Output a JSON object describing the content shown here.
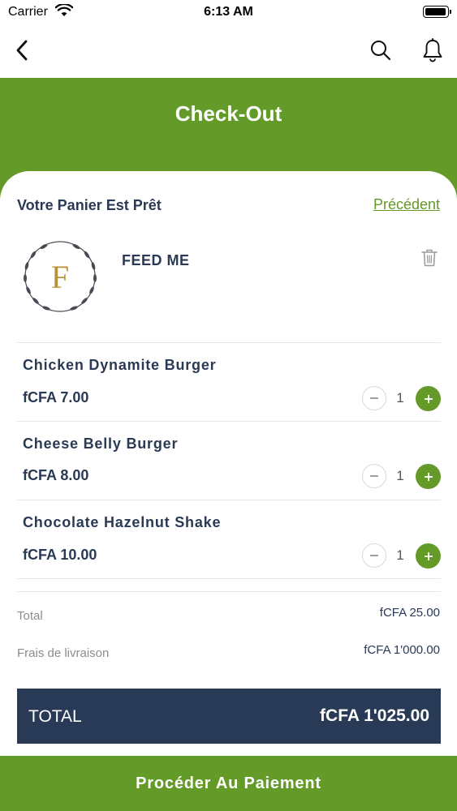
{
  "status_bar": {
    "carrier": "Carrier",
    "time": "6:13 AM",
    "battery_level": 1.0
  },
  "nav": {
    "back_icon": "chevron-left-icon",
    "search_icon": "search-icon",
    "bell_icon": "bell-icon"
  },
  "header": {
    "title": "Check-Out",
    "color": "#639a28"
  },
  "cart": {
    "heading": "Votre Panier Est Prêt",
    "previous_link": "Précédent",
    "restaurant": {
      "logo_letter": "F",
      "name": "FEED ME"
    },
    "items": [
      {
        "name": "Chicken Dynamite Burger",
        "price": "fCFA 7.00",
        "quantity": "1"
      },
      {
        "name": "Cheese Belly Burger",
        "price": "fCFA 8.00",
        "quantity": "1"
      },
      {
        "name": "Chocolate Hazelnut Shake",
        "price": "fCFA 10.00",
        "quantity": "1"
      }
    ]
  },
  "summary": {
    "subtotal_label": "Total",
    "subtotal_value": "fCFA 25.00",
    "delivery_label": "Frais de livraison",
    "delivery_value": "fCFA 1'000.00"
  },
  "total": {
    "label": "TOTAL",
    "value": "fCFA 1'025.00",
    "color": "#283a55"
  },
  "pay_button": {
    "label": "Procéder Au Paiement"
  }
}
